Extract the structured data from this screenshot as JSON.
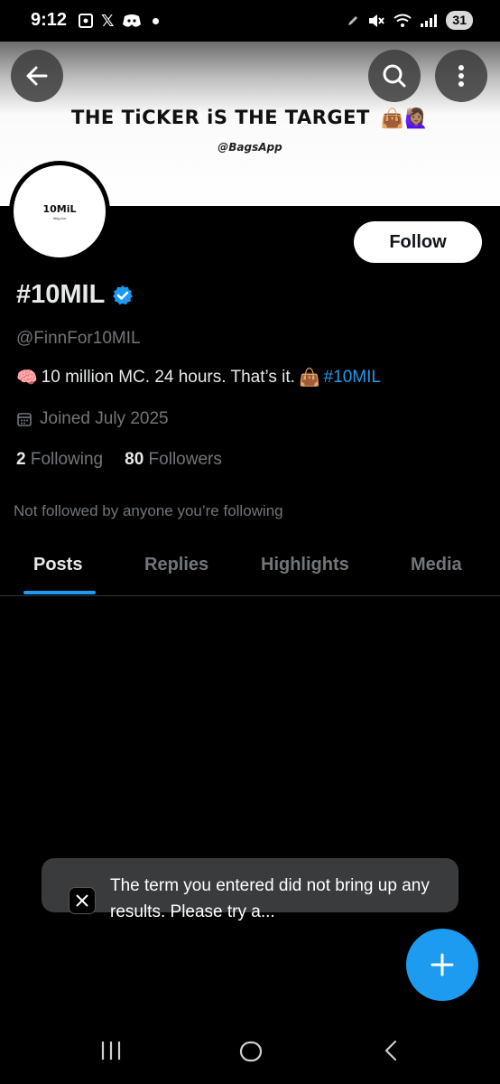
{
  "status_bar": {
    "time": "9:12",
    "battery": "31",
    "icons": [
      "screenshot-icon",
      "x-app-icon",
      "discord-icon",
      "dot-icon",
      "mute-icon",
      "wifi-icon",
      "signal-icon",
      "battery-icon"
    ]
  },
  "banner": {
    "headline": "THE TiCKER iS THE TARGET",
    "emoji": "👜🙋🏽‍♀️",
    "subtext": "@BagsApp"
  },
  "header": {
    "back_icon": "arrow-left-icon",
    "search_icon": "search-icon",
    "more_icon": "more-vertical-icon"
  },
  "avatar": {
    "text": "10MiL",
    "subtext": "#blg.fun"
  },
  "profile": {
    "follow_label": "Follow",
    "display_name": "#10MIL",
    "verified_icon": "verified-badge-icon",
    "handle": "@FinnFor10MIL",
    "bio_emoji": "🧠",
    "bio_text": "10 million MC. 24 hours. That’s it.",
    "bio_emoji_end": "👜",
    "bio_hashtag": "#10MIL",
    "joined": "Joined July 2025",
    "following_count": "2",
    "following_label": "Following",
    "followers_count": "80",
    "followers_label": "Followers",
    "not_followed": "Not followed by anyone you’re following"
  },
  "tabs": [
    {
      "label": "Posts",
      "active": true
    },
    {
      "label": "Replies",
      "active": false
    },
    {
      "label": "Highlights",
      "active": false
    },
    {
      "label": "Media",
      "active": false
    }
  ],
  "toast": {
    "text": "The term you entered did not bring up any results. Please try a..."
  },
  "fab": {
    "icon": "plus-icon"
  },
  "nav": {
    "recents": "recents-icon",
    "home": "home-icon",
    "back": "back-icon"
  },
  "colors": {
    "accent": "#1d9bf0",
    "background": "#000000",
    "muted": "#71767b",
    "toast": "#3a3b3d"
  }
}
